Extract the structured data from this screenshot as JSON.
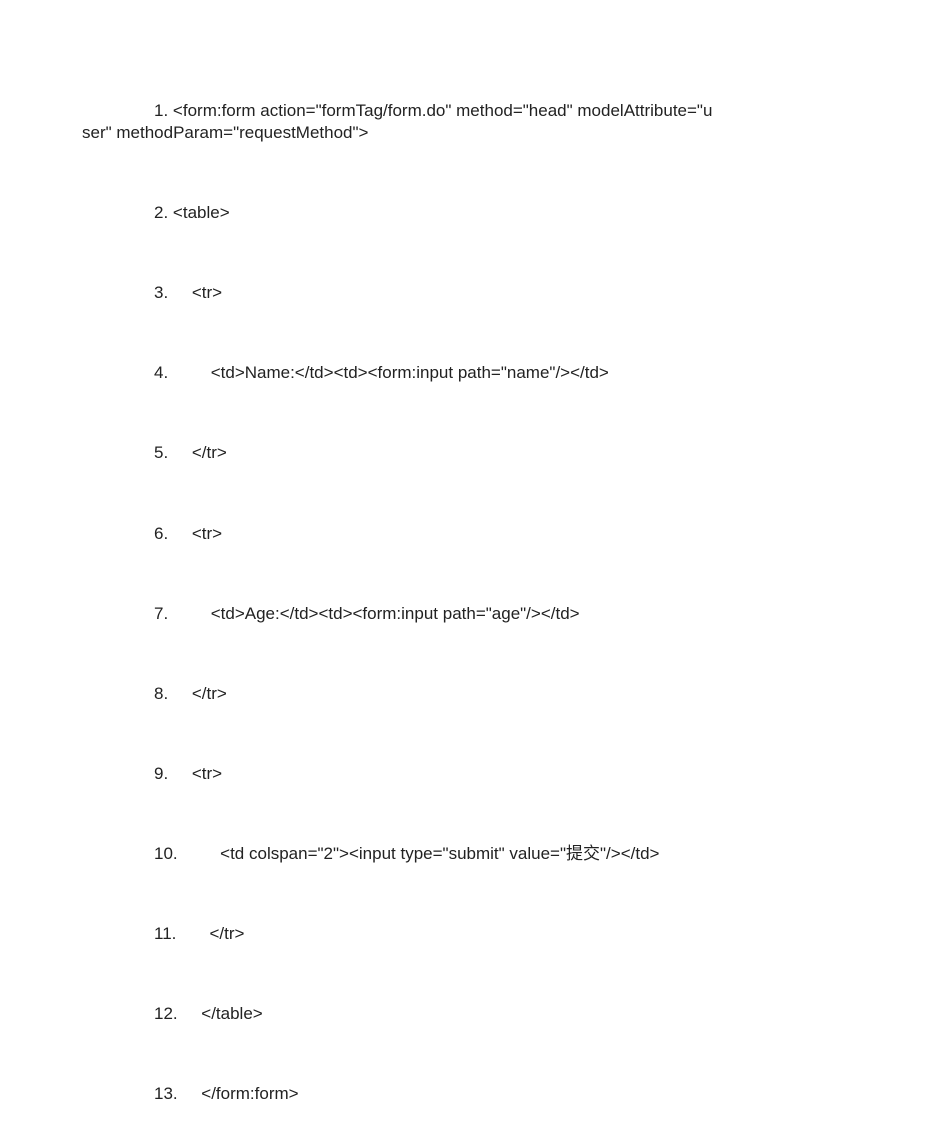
{
  "code": {
    "lines": [
      {
        "num": "1.",
        "text_a": "<form:form action=\"formTag/form.do\" method=\"head\" modelAttribute=\"u",
        "text_b": "ser\" methodParam=\"requestMethod\">"
      },
      {
        "num": "2.",
        "text": "<table>"
      },
      {
        "num": "3.",
        "text": "    <tr>"
      },
      {
        "num": "4.",
        "text": "        <td>Name:</td><td><form:input path=\"name\"/></td>"
      },
      {
        "num": "5.",
        "text": "    </tr>"
      },
      {
        "num": "6.",
        "text": "    <tr>"
      },
      {
        "num": "7.",
        "text": "        <td>Age:</td><td><form:input path=\"age\"/></td>"
      },
      {
        "num": "8.",
        "text": "    </tr>"
      },
      {
        "num": "9.",
        "text": "    <tr>"
      },
      {
        "num": "10.",
        "text": "        <td colspan=\"2\"><input type=\"submit\" value=\"提交\"/></td>"
      },
      {
        "num": "11.",
        "text": "      </tr>"
      },
      {
        "num": "12.",
        "text": "    </table>"
      },
      {
        "num": "13.",
        "text": "    </form:form>"
      }
    ]
  }
}
